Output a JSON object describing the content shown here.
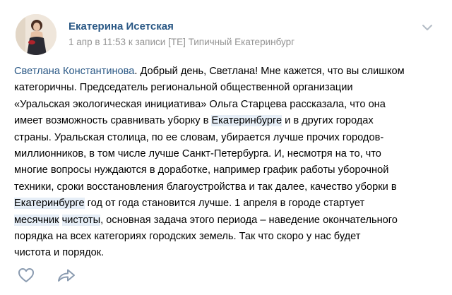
{
  "comment": {
    "author": "Екатерина Исетская",
    "meta": {
      "date": "1 апр в 11:53",
      "prefix": "к записи",
      "group": "[ТЕ] Типичный Екатеринбург"
    },
    "text": {
      "mention": "Светлана Константинова",
      "l1_rest": ". Добрый день, Светлана! Мне кажется, что вы слишком",
      "l2": "категоричны. Председатель региональной общественной организации",
      "l3": "«Уральская экологическая инициатива» Ольга Старцева рассказала, что она",
      "l4_a": "имеет возможность сравнивать уборку в ",
      "l4_hl": "Екатеринбурге",
      "l4_b": " и в других городах",
      "l5": "страны. Уральская столица, по ее словам, убирается лучше прочих городов-",
      "l6": "миллионников, в том числе лучше Санкт-Петербурга. И, несмотря на то, что",
      "l7": "многие вопросы нуждаются в доработке, например график работы уборочной",
      "l8": "техники, сроки восстановления благоустройства и так далее, качество уборки в",
      "l9_hl": "Екатеринбурге",
      "l9_b": " год от года становится лучше. 1 апреля в городе стартует",
      "l10_hl1": "месячник",
      "l10_hl2": "чистоты",
      "l10_b": ", основная задача этого периода – наведение окончательного",
      "l11": "порядка на всех категориях городских земель. Так что скоро у нас будет",
      "l12": "чистота и порядок."
    }
  },
  "colors": {
    "link": "#2a5885",
    "meta": "#939393",
    "highlight": "#e6eef7",
    "icon": "#8a9bb0"
  },
  "icons": [
    "avatar",
    "chevron-down-icon",
    "heart-icon",
    "share-arrow-icon"
  ]
}
